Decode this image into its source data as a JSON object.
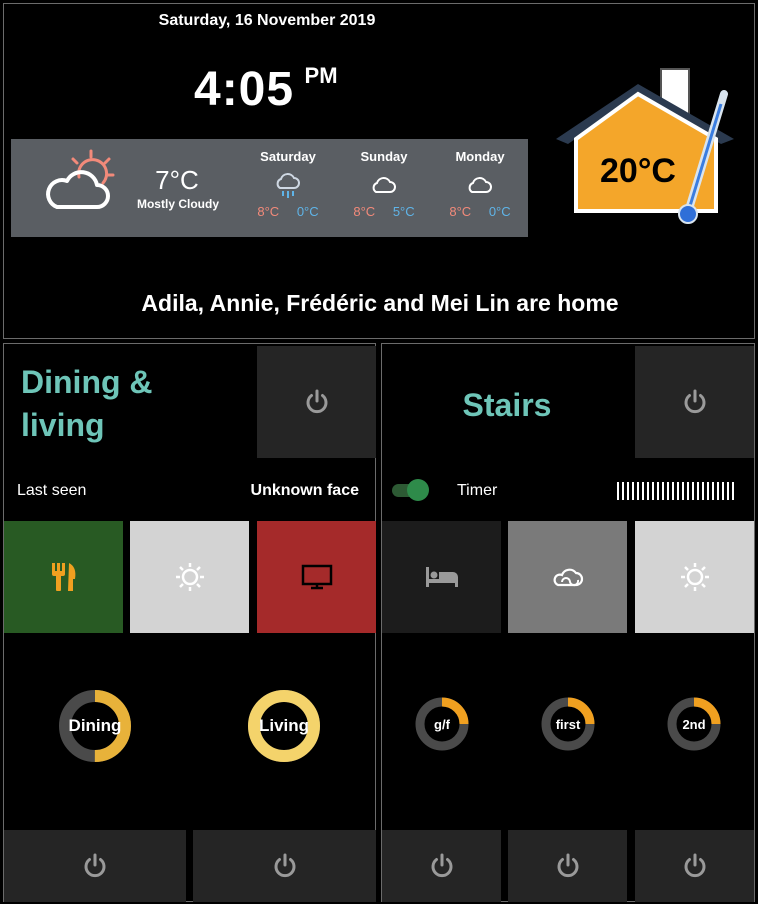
{
  "header": {
    "date": "Saturday, 16 November 2019",
    "time": "4:05",
    "ampm": "PM",
    "indoor_temp": "20°C",
    "presence": "Adila, Annie, Frédéric and Mei Lin are home"
  },
  "weather": {
    "current_temp": "7°C",
    "current_condition": "Mostly Cloudy",
    "current_icon": "partly-cloudy-day-icon",
    "forecast": [
      {
        "day": "Saturday",
        "high": "8°C",
        "low": "0°C",
        "icon": "rain-cloud-icon"
      },
      {
        "day": "Sunday",
        "high": "8°C",
        "low": "5°C",
        "icon": "cloud-icon"
      },
      {
        "day": "Monday",
        "high": "8°C",
        "low": "0°C",
        "icon": "cloud-icon"
      }
    ]
  },
  "dining_living": {
    "title": "Dining & living",
    "last_seen_label": "Last seen",
    "last_seen_value": "Unknown face",
    "scenes": [
      {
        "icon": "utensils-icon",
        "color": "#285a23",
        "icon_color": "#f0a020"
      },
      {
        "icon": "sun-icon",
        "color": "#d3d3d3",
        "icon_color": "#ffffff"
      },
      {
        "icon": "tv-icon",
        "color": "#a52a2a",
        "icon_color": "#000000"
      }
    ],
    "dimmers": [
      {
        "label": "Dining",
        "level": 0.5,
        "color": "#e8b23a"
      },
      {
        "label": "Living",
        "level": 1.0,
        "color": "#f4d36b"
      }
    ]
  },
  "stairs": {
    "title": "Stairs",
    "timer_label": "Timer",
    "toggle_on": true,
    "scenes": [
      {
        "icon": "bed-icon",
        "color": "#1c1c1c",
        "icon_color": "#9a9a9a"
      },
      {
        "icon": "cloud-swirl-icon",
        "color": "#7a7a7a",
        "icon_color": "#ffffff"
      },
      {
        "icon": "sun-icon",
        "color": "#d3d3d3",
        "icon_color": "#ffffff"
      }
    ],
    "dimmers": [
      {
        "label": "g/f",
        "level": 0.25,
        "color": "#f0a020"
      },
      {
        "label": "first",
        "level": 0.25,
        "color": "#f0a020"
      },
      {
        "label": "2nd",
        "level": 0.25,
        "color": "#f0a020"
      }
    ]
  },
  "colors": {
    "accent_teal": "#6ec5b8",
    "tile_dark": "#252525",
    "power_icon": "#9a9a9a"
  }
}
